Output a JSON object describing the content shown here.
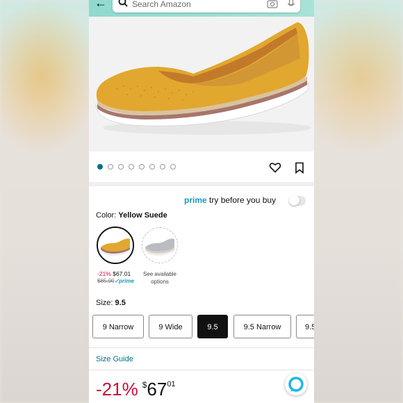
{
  "search": {
    "placeholder": "Search Amazon"
  },
  "gallery": {
    "dot_count": 8,
    "active_index": 0
  },
  "prime": {
    "brand": "prime",
    "label": "try before you buy",
    "enabled": false
  },
  "color": {
    "label": "Color:",
    "selected": "Yellow Suede",
    "options": [
      {
        "name": "yellow-suede",
        "discount": "-21%",
        "price": "$67.01",
        "list_price": "$85.00",
        "prime": "prime"
      },
      {
        "name": "grey",
        "text": "See available options"
      }
    ]
  },
  "size": {
    "label": "Size:",
    "selected": "9.5",
    "options": [
      "9 Narrow",
      "9 Wide",
      "9.5",
      "9.5 Narrow",
      "9.5"
    ]
  },
  "size_guide": "Size Guide",
  "price": {
    "discount": "-21%",
    "currency": "$",
    "whole": "67",
    "fraction": "01"
  },
  "colors": {
    "header": "#9fe0d4",
    "accent_link": "#007185",
    "prime_blue": "#1a98c5",
    "discount_red": "#cc0c39",
    "shoe": "#e2a72e"
  },
  "icons": [
    "back-arrow-icon",
    "search-icon",
    "camera-icon",
    "mic-icon",
    "heart-icon",
    "bookmark-icon",
    "alexa-icon"
  ]
}
